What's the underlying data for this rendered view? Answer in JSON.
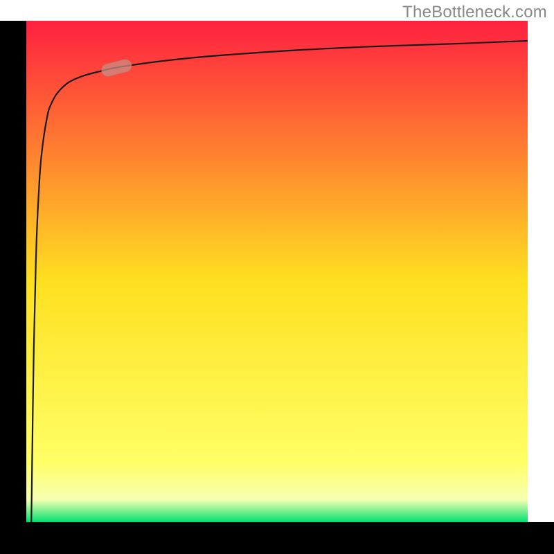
{
  "watermark": "TheBottleneck.com",
  "colors": {
    "border": "#000000",
    "curve": "#1a1a1a",
    "marker_fill": "#c99085",
    "marker_stroke": "#b07a70",
    "grad_top": "#ff2040",
    "grad_mid": "#ffe020",
    "grad_low": "#ffff66",
    "grad_bottom": "#00e070"
  },
  "chart_data": {
    "type": "line",
    "title": "",
    "xlabel": "",
    "ylabel": "",
    "xlim": [
      0,
      100
    ],
    "ylim": [
      0,
      100
    ],
    "series": [
      {
        "name": "curve",
        "x": [
          1,
          1.2,
          1.5,
          2,
          2.5,
          3,
          4,
          5,
          7,
          10,
          15,
          20,
          30,
          40,
          55,
          70,
          85,
          100
        ],
        "y": [
          0,
          15,
          35,
          55,
          66,
          73,
          80,
          83.5,
          86.5,
          88.5,
          90,
          91,
          92.3,
          93.2,
          94.2,
          94.9,
          95.4,
          96
        ]
      }
    ],
    "marker": {
      "x": 18,
      "y": 90.6,
      "angle_deg": 14
    },
    "gradient_stops": [
      {
        "offset": 0.0,
        "y": 100,
        "color": "#ff2040"
      },
      {
        "offset": 0.52,
        "y": 48,
        "color": "#ffe020"
      },
      {
        "offset": 0.88,
        "y": 12,
        "color": "#ffff66"
      },
      {
        "offset": 0.955,
        "y": 4.5,
        "color": "#f6ffb0"
      },
      {
        "offset": 1.0,
        "y": 0,
        "color": "#00e070"
      }
    ]
  }
}
